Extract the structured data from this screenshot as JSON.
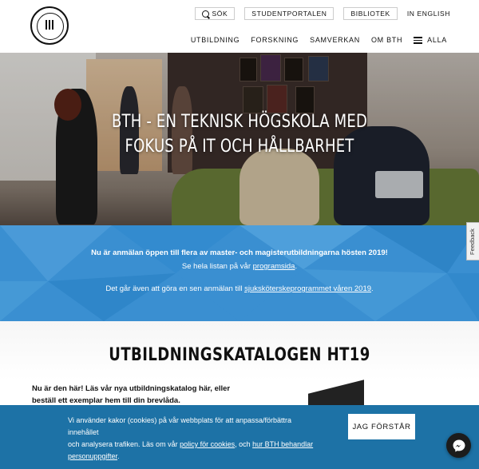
{
  "header": {
    "logo_text": "BLEKINGE TEKNISKA HÖGSKOLA · BTH",
    "search_label": "SÖK",
    "student_portal_label": "STUDENTPORTALEN",
    "library_label": "BIBLIOTEK",
    "language_label": "IN ENGLISH",
    "nav": [
      {
        "label": "UTBILDNING"
      },
      {
        "label": "FORSKNING"
      },
      {
        "label": "SAMVERKAN"
      },
      {
        "label": "OM BTH"
      },
      {
        "label": "ALLA"
      }
    ]
  },
  "hero": {
    "title_line1": "BTH - EN TEKNISK HÖGSKOLA MED",
    "title_line2": "FOKUS PÅ IT OCH HÅLLBARHET"
  },
  "announcement": {
    "headline": "Nu är anmälan öppen till flera av master- och magisterutbildningarna hösten 2019!",
    "line2_prefix": "Se hela listan på vår ",
    "line2_link": "programsida",
    "line2_suffix": ".",
    "line3_prefix": "Det går även att göra en sen anmälan till ",
    "line3_link": "sjuksköterskeprogrammet våren 2019",
    "line3_suffix": "."
  },
  "feedback_label": "Feedback",
  "catalog": {
    "title": "UTBILDNINGSKATALOGEN HT19",
    "text_line1": "Nu är den här! Läs vår nya utbildningskatalog här, eller",
    "text_line2": "beställ ett exemplar hem till din brevlåda."
  },
  "cookie": {
    "text_1": "Vi använder kakor (cookies) på vår webbplats för att anpassa/förbättra innehållet",
    "text_2": "och analysera trafiken. Läs om vår ",
    "link_1": "policy för cookies",
    "text_3": ", och ",
    "link_2": "hur BTH behandlar",
    "link_2b": "personuppgifter",
    "text_4": ".",
    "button_label": "JAG FÖRSTÅR"
  },
  "colors": {
    "announcement_blue": "#3a8fd1",
    "cookie_blue": "#1d72a6"
  },
  "icons": [
    "search-icon",
    "menu-icon",
    "messenger-icon"
  ]
}
